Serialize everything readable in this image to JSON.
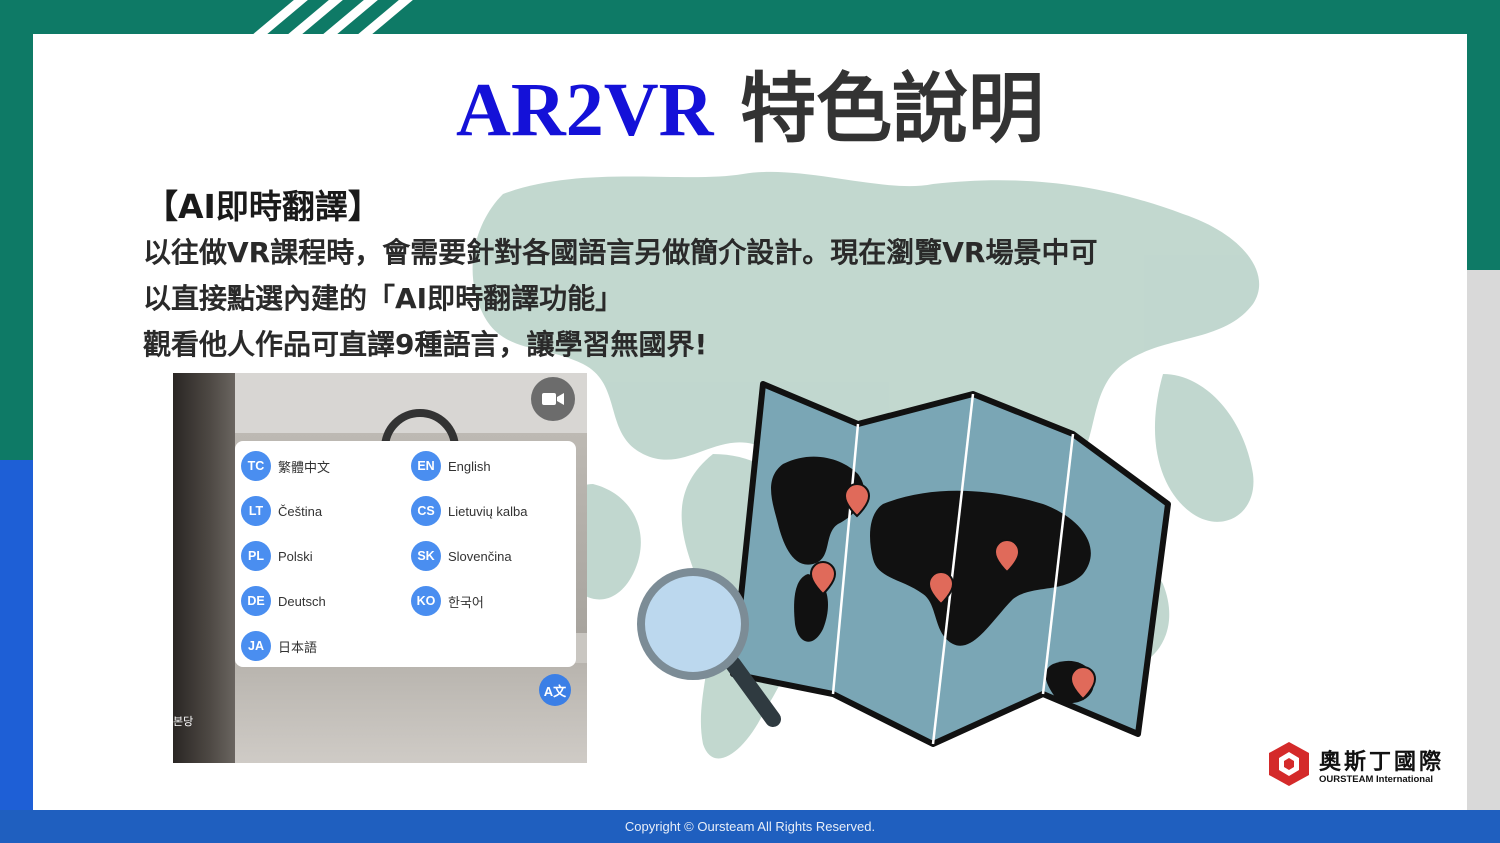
{
  "title_latin": "AR2VR",
  "title_cjk": "特色說明",
  "subtitle": "【AI即時翻譯】",
  "description": [
    "以往做VR課程時，會需要針對各國語言另做簡介設計。現在瀏覽VR場景中可",
    "以直接點選內建的「AI即時翻譯功能」",
    "觀看他人作品可直譯9種語言，讓學習無國界!"
  ],
  "languages": [
    {
      "code": "TC",
      "name": "繁體中文"
    },
    {
      "code": "EN",
      "name": "English"
    },
    {
      "code": "LT",
      "name": "Čeština"
    },
    {
      "code": "CS",
      "name": "Lietuvių kalba"
    },
    {
      "code": "PL",
      "name": "Polski"
    },
    {
      "code": "SK",
      "name": "Slovenčina"
    },
    {
      "code": "DE",
      "name": "Deutsch"
    },
    {
      "code": "KO",
      "name": "한국어"
    },
    {
      "code": "JA",
      "name": "日本語"
    }
  ],
  "screenshot_corner_text": "본당",
  "translate_button": "A文",
  "logo": {
    "name": "奧斯丁國際",
    "subtitle": "OURSTEAM International"
  },
  "footer": "Copyright © Oursteam All Rights Reserved.",
  "colors": {
    "teal": "#0e7a66",
    "blue": "#1f5fbf",
    "title_blue": "#1411d8",
    "lang_badge": "#4a8ef0",
    "map_blue": "#7aa6b5",
    "pin": "#e06a5a",
    "logo_red": "#d42a2a"
  }
}
